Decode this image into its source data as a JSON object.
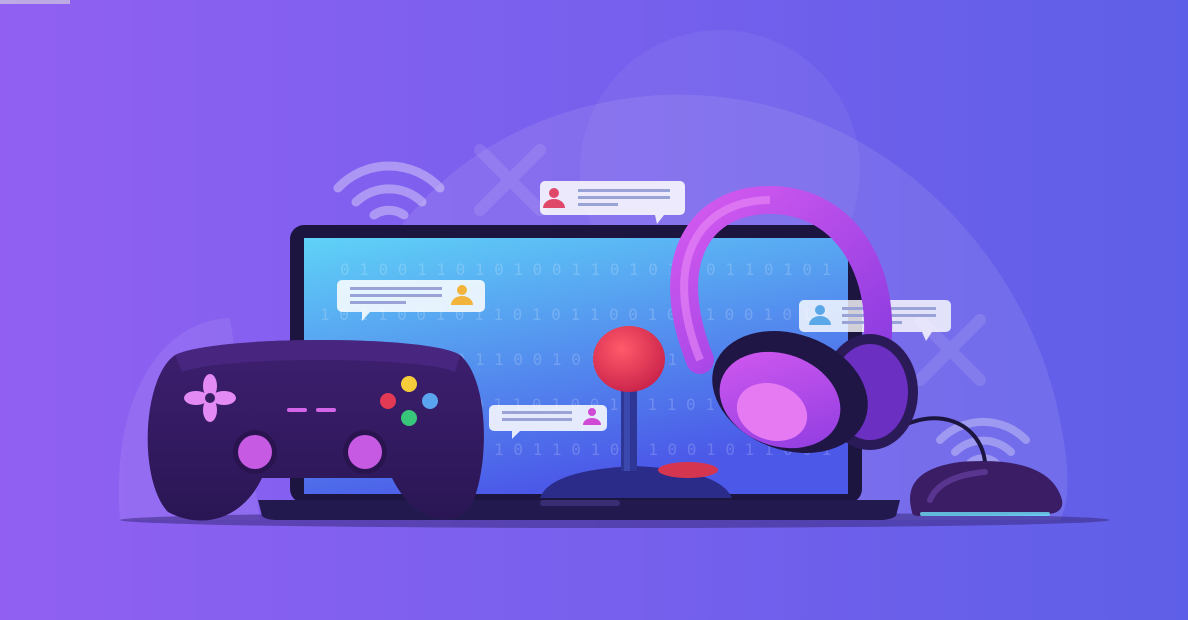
{
  "scene": {
    "colors": {
      "bg_left": "#8e5cf0",
      "bg_right": "#5d5fe8",
      "device_dark": "#1f1646",
      "screen_top": "#62c8f6",
      "screen_bottom": "#4e5be8",
      "gamepad": "#351c63",
      "accent_pink": "#e05ad6",
      "accent_red": "#e23c55",
      "headphone": "#c252ea"
    },
    "icons": [
      "wifi-icon",
      "laptop-icon",
      "gamepad-icon",
      "joystick-icon",
      "headphones-icon",
      "mouse-icon",
      "chat-bubble-icon",
      "user-avatar-icon"
    ]
  }
}
